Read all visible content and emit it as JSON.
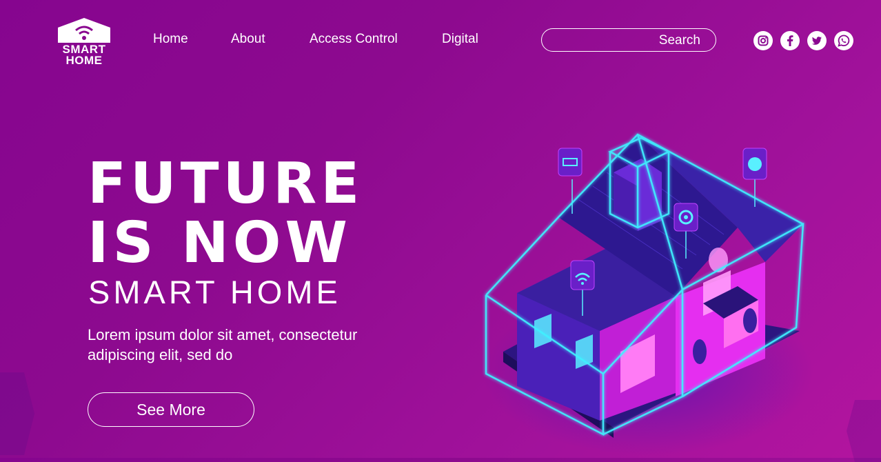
{
  "brand": {
    "line1": "SMART",
    "line2": "HOME"
  },
  "nav": [
    {
      "label": "Home"
    },
    {
      "label": "About"
    },
    {
      "label": "Access Control"
    },
    {
      "label": "Digital"
    }
  ],
  "search": {
    "placeholder": "",
    "value": "",
    "button_label": "Search"
  },
  "social": [
    "instagram-icon",
    "facebook-icon",
    "twitter-icon",
    "whatsapp-icon"
  ],
  "hero": {
    "title_line1": "FUTURE",
    "title_line2": "IS NOW",
    "subtitle": "SMART HOME",
    "description": "Lorem ipsum dolor sit amet, consectetur adipiscing elit, sed do",
    "cta_label": "See More"
  },
  "colors": {
    "background": "#8a0890",
    "accent_neon": "#3ff0ff",
    "house_pink": "#e52ef0",
    "house_indigo": "#3a1fa0",
    "text": "#ffffff"
  }
}
